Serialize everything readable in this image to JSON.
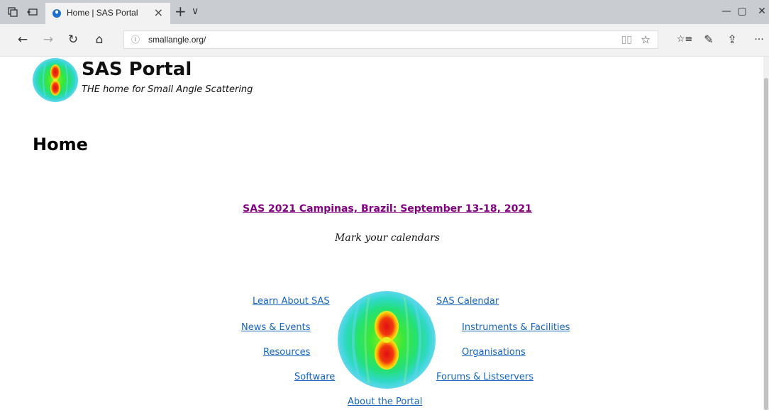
{
  "browser": {
    "tab": {
      "title": "Home | SAS Portal",
      "close": "×"
    },
    "new_tab": "+",
    "tab_list": "∨",
    "window": {
      "minimize": "—",
      "restore": "▢",
      "close": "✕"
    },
    "nav": {
      "back": "←",
      "forward": "→",
      "refresh": "↻",
      "home": "⌂"
    },
    "address": {
      "info": "ⓘ",
      "url": "smallangle.org/",
      "reading_view": "▯▯",
      "favorite": "☆"
    },
    "toolbar": {
      "favorites": "☆≡",
      "notes": "✎",
      "share": "⇪",
      "more": "···"
    }
  },
  "site": {
    "name": "SAS Portal",
    "slogan": "THE home for Small Angle Scattering"
  },
  "page": {
    "title": "Home",
    "announcement": "SAS 2021 Campinas, Brazil: September 13-18, 2021",
    "announcement_sub": "Mark your calendars"
  },
  "links": {
    "learn": "Learn About SAS",
    "news": "News & Events",
    "resources": "Resources",
    "software": "Software",
    "about": "About the Portal",
    "calendar": "SAS Calendar",
    "instruments": "Instruments & Facilities",
    "organisations": "Organisations",
    "forums": "Forums & Listservers"
  },
  "colors": {
    "link": "#1565c0",
    "visited_link": "#800080",
    "tab_bar": "#c9cdd2",
    "browser_bar": "#f2f2f2"
  },
  "icons": {
    "set_tabs_aside": "tabs-aside-icon",
    "show_tabs": "show-tabs-icon",
    "favicon": "sas-favicon-icon",
    "logo": "scattering-pattern-logo"
  }
}
